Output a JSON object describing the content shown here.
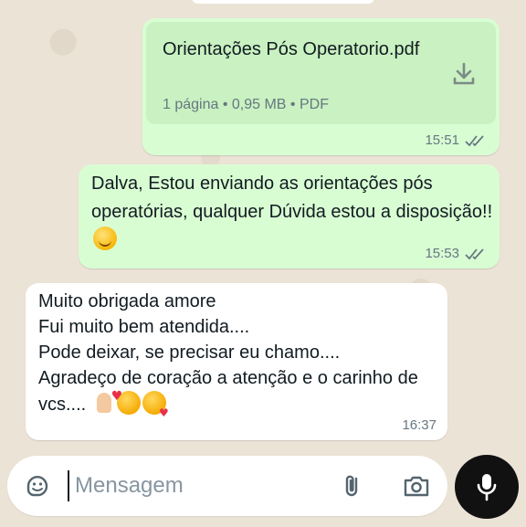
{
  "pdf_message": {
    "file_name": "Orientações Pós Operatorio.pdf",
    "meta": "1 página • 0,95 MB • PDF",
    "time": "15:51",
    "icon": "download-icon"
  },
  "outgoing_message": {
    "text": "Dalva, Estou enviando as orientações pós operatórias, qualquer Dúvida estou a disposição!!",
    "time": "15:53",
    "emoji": "smiling-face"
  },
  "incoming_message": {
    "text": "Muito obrigada amore\nFui muito bem atendida....\nPode deixar, se precisar eu chamo....\nAgradeço de coração a atenção e o carinho de vcs....",
    "time": "16:37",
    "emojis": [
      "folded-hands",
      "smiling-face-with-hearts",
      "face-blowing-kiss"
    ]
  },
  "composer": {
    "placeholder": "Mensagem",
    "icons": [
      "sticker-icon",
      "attach-icon",
      "camera-icon",
      "mic-icon"
    ]
  },
  "colors": {
    "outgoing_bubble": "#d9fdd3",
    "incoming_bubble": "#ffffff",
    "read_ticks": "#667781",
    "mic_button": "#111111"
  }
}
